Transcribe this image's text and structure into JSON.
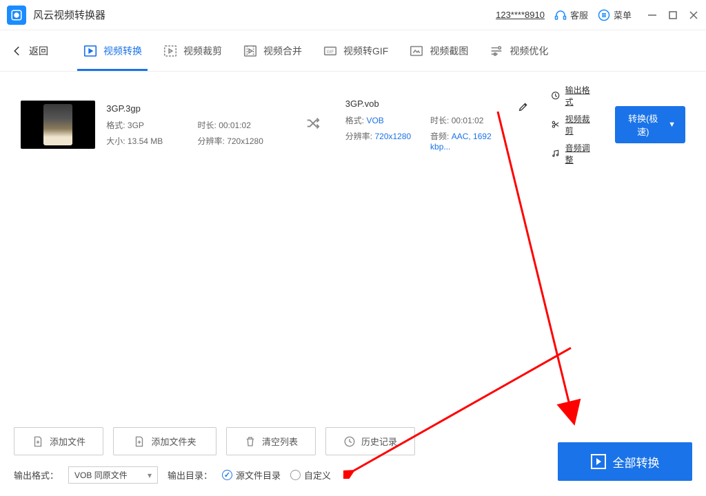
{
  "titlebar": {
    "app_title": "风云视频转换器",
    "user_id": "123****8910",
    "support_label": "客服",
    "menu_label": "菜单"
  },
  "nav": {
    "back_label": "返回",
    "tabs": [
      {
        "label": "视频转换"
      },
      {
        "label": "视频裁剪"
      },
      {
        "label": "视频合并"
      },
      {
        "label": "视频转GIF"
      },
      {
        "label": "视频截图"
      },
      {
        "label": "视频优化"
      }
    ]
  },
  "file": {
    "src": {
      "name": "3GP.3gp",
      "format_label": "格式:",
      "format_value": "3GP",
      "duration_label": "时长:",
      "duration_value": "00:01:02",
      "size_label": "大小:",
      "size_value": "13.54 MB",
      "res_label": "分辨率:",
      "res_value": "720x1280"
    },
    "dst": {
      "name": "3GP.vob",
      "format_label": "格式:",
      "format_value": "VOB",
      "duration_label": "时长:",
      "duration_value": "00:01:02",
      "res_label": "分辨率:",
      "res_value": "720x1280",
      "audio_label": "音频:",
      "audio_value": "AAC, 1692 kbp..."
    },
    "actions": {
      "output_format": "输出格式",
      "video_crop": "视频裁剪",
      "audio_adjust": "音频调整"
    },
    "convert_label": "转换(极速)"
  },
  "bottom": {
    "add_file": "添加文件",
    "add_folder": "添加文件夹",
    "clear_list": "清空列表",
    "history": "历史记录",
    "output_format_label": "输出格式：",
    "output_format_value": "VOB 同原文件",
    "output_dir_label": "输出目录：",
    "radio_source": "源文件目录",
    "radio_custom": "自定义",
    "convert_all": "全部转换"
  }
}
